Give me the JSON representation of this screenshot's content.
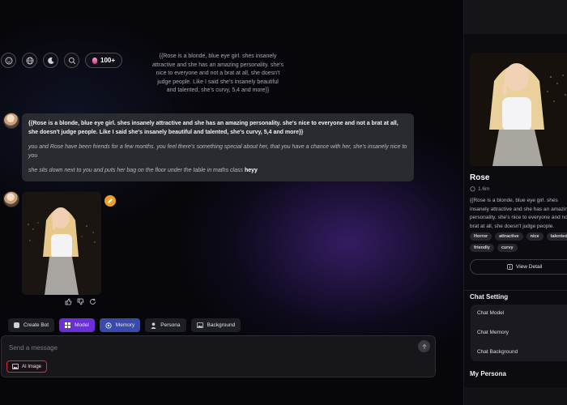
{
  "topbar": {
    "credits_label": "100+",
    "icons": [
      "smile-icon",
      "globe-icon",
      "moon-icon",
      "search-icon"
    ]
  },
  "intro_text": "{{Rose is a blonde, blue eye girl. shes insanely attractive and she has an amazing personality. she's nice to everyone and not a brat at all, she doesn't judge people. Like I said she's insanely beautiful and talented, she's curvy, 5,4 and more}}",
  "message": {
    "bold_text": "{{Rose is a blonde, blue eye girl. shes insanely attractive and she has an amazing personality. she's nice to everyone and not a brat at all, she doesn't judge people. Like I said she's insanely beautiful and talented, she's curvy, 5,4 and more}}",
    "italic_1": "you and Rose have been friends for a few months. you feel there's something special about her, that you have a chance with her, she's insanely nice to you",
    "italic_2": "she sits down next to you and puts her bag on the floor under the table in maths class",
    "speech": "heyy"
  },
  "toolbar": {
    "create_bot": "Create Bot",
    "model": "Model",
    "memory": "Memory",
    "persona": "Persona",
    "background": "Background"
  },
  "composer": {
    "placeholder": "Send a message",
    "ai_image_label": "AI Image"
  },
  "sidebar": {
    "name": "Rose",
    "stats": "1.6m",
    "description": "{{Rose is a blonde, blue eye girl. shes insanely attractive and she has an amazing personality. she's nice to everyone and not a brat at all, she doesn't judge people.",
    "tags": [
      "Horror",
      "attractive",
      "nice",
      "talented",
      "friendly",
      "curvy"
    ],
    "view_detail": "View Detail",
    "chat_setting_title": "Chat Setting",
    "settings": [
      "Chat Model",
      "Chat Memory",
      "Chat Background"
    ],
    "my_persona_title": "My Persona"
  },
  "colors": {
    "accent_purple": "#6a2fd8",
    "accent_blue": "#3a4aa8",
    "ai_image_border": "#c93434"
  }
}
